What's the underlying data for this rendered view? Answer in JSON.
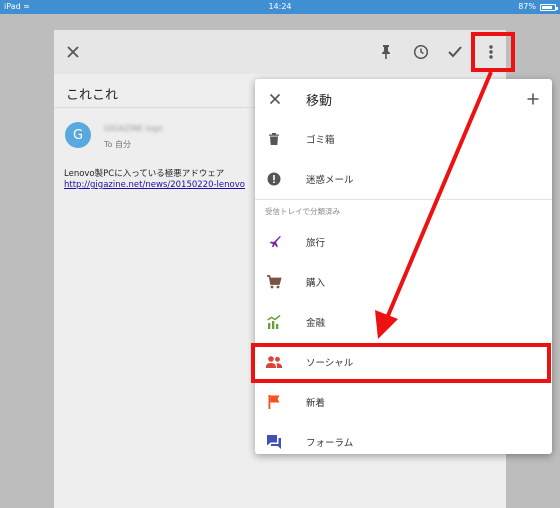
{
  "status_bar": {
    "device": "iPad",
    "time": "14:24",
    "battery": "87%",
    "battery_level": 0.87
  },
  "email": {
    "toolbar": {
      "icons": [
        "close-icon",
        "pin-icon",
        "clock-icon",
        "check-icon",
        "more-vert-icon"
      ]
    },
    "subject": "これこれ",
    "avatar_letter": "G",
    "sender": "GIGAZINE logo",
    "to": "To 自分",
    "body_line": "Lenovo製PCに入っている極悪アドウェア",
    "link": "http://gigazine.net/news/20150220-lenovo"
  },
  "menu": {
    "title": "移動",
    "items": [
      {
        "label": "ゴミ箱",
        "icon": "trash-icon"
      },
      {
        "label": "迷惑メール",
        "icon": "spam-icon"
      }
    ],
    "section_label": "受信トレイで分類済み",
    "categories": [
      {
        "label": "旅行",
        "icon": "airplane-icon"
      },
      {
        "label": "購入",
        "icon": "cart-icon"
      },
      {
        "label": "金融",
        "icon": "finance-icon"
      },
      {
        "label": "ソーシャル",
        "icon": "people-icon"
      },
      {
        "label": "新着",
        "icon": "flag-icon"
      },
      {
        "label": "フォーラム",
        "icon": "forum-icon"
      }
    ]
  },
  "colors": {
    "status_bar": "#3f8fd2",
    "annotation_red": "#ee1111",
    "travel": "#7b1fa2",
    "purchase": "#795548",
    "finance": "#689f38",
    "social": "#db4437",
    "updates": "#f4511e",
    "forums": "#3f51b5"
  }
}
